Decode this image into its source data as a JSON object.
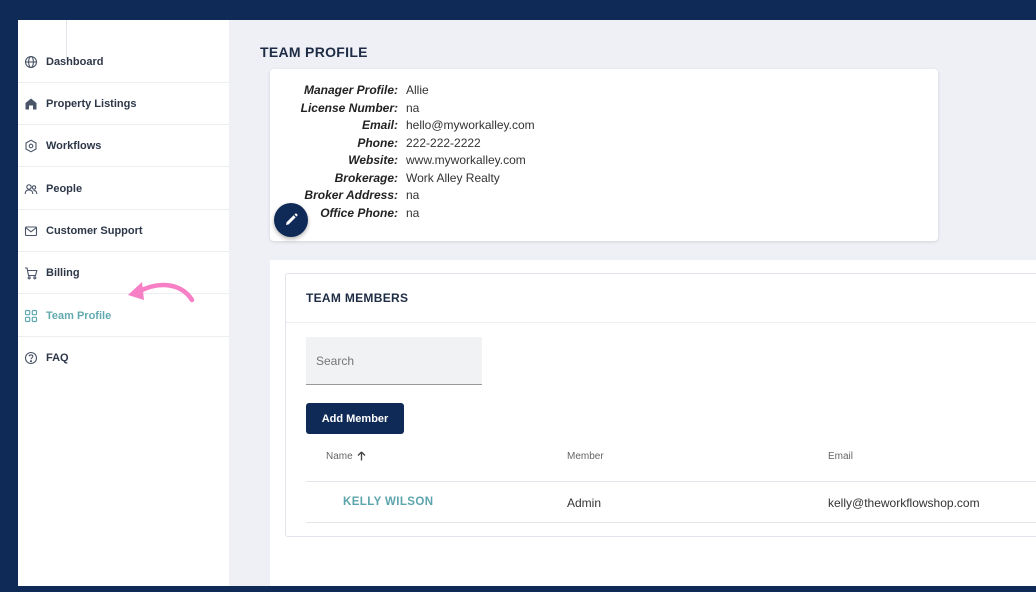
{
  "sidebar": {
    "items": [
      {
        "label": "Dashboard",
        "icon": "globe-icon"
      },
      {
        "label": "Property Listings",
        "icon": "home-icon"
      },
      {
        "label": "Workflows",
        "icon": "hexagon-icon"
      },
      {
        "label": "People",
        "icon": "people-icon"
      },
      {
        "label": "Customer Support",
        "icon": "mail-icon"
      },
      {
        "label": "Billing",
        "icon": "cart-icon"
      },
      {
        "label": "Team Profile",
        "icon": "grid-icon",
        "active": true
      },
      {
        "label": "FAQ",
        "icon": "help-icon"
      }
    ],
    "active_color": "#62aab0"
  },
  "page": {
    "title": "TEAM PROFILE"
  },
  "profile": {
    "rows": [
      {
        "key": "Manager Profile:",
        "value": "Allie"
      },
      {
        "key": "License Number:",
        "value": "na"
      },
      {
        "key": "Email:",
        "value": "hello@myworkalley.com"
      },
      {
        "key": "Phone:",
        "value": "222-222-2222"
      },
      {
        "key": "Website:",
        "value": "www.myworkalley.com"
      },
      {
        "key": "Brokerage:",
        "value": "Work Alley Realty"
      },
      {
        "key": "Broker Address:",
        "value": "na"
      },
      {
        "key": "Office Phone:",
        "value": "na"
      }
    ]
  },
  "members": {
    "title": "TEAM MEMBERS",
    "search_placeholder": "Search",
    "add_label": "Add Member",
    "columns": [
      "Name",
      "Member",
      "Email"
    ],
    "rows": [
      {
        "name": "KELLY WILSON",
        "member": "Admin",
        "email": "kelly@theworkflowshop.com"
      }
    ]
  },
  "colors": {
    "navy": "#0f2a56",
    "background": "#eef0f6",
    "accent_teal": "#62aab0",
    "annotation_pink": "#f77fc6"
  }
}
